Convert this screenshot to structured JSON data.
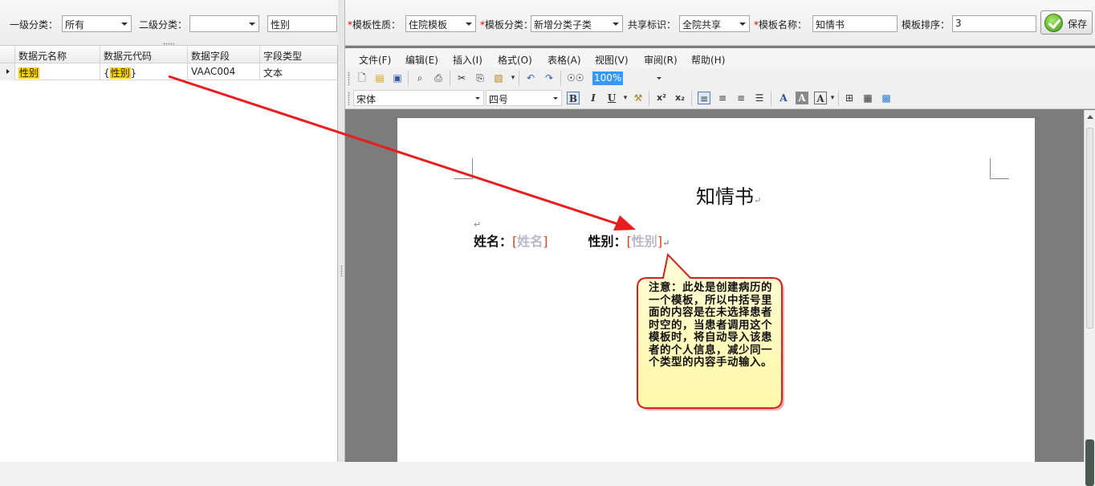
{
  "left": {
    "filter": {
      "level1_label": "一级分类：",
      "level1_value": "所有",
      "level2_label": "二级分类：",
      "level2_value": "",
      "search_value": "性别"
    },
    "grid": {
      "columns": [
        "数据元名称",
        "数据元代码",
        "数据字段",
        "字段类型"
      ],
      "rows": [
        {
          "name": "性别",
          "code_open": "{",
          "code": "性别",
          "code_close": "}",
          "field": "VAAC004",
          "type": "文本"
        }
      ]
    }
  },
  "template": {
    "nature_label": "模板性质：",
    "nature_value": "住院模板",
    "category_label": "模板分类：",
    "category_value": "新增分类子类",
    "share_label": "共享标识：",
    "share_value": "全院共享",
    "name_label": "模板名称：",
    "name_value": "知情书",
    "order_label": "模板排序：",
    "order_value": "3",
    "required_mark": "*",
    "save_label": "保存"
  },
  "menu": [
    "文件(F)",
    "编辑(E)",
    "插入(I)",
    "格式(O)",
    "表格(A)",
    "视图(V)",
    "审阅(R)",
    "帮助(H)"
  ],
  "toolbar": {
    "zoom": "100%",
    "font_name": "宋体",
    "font_size": "四号",
    "bold": "B",
    "italic": "I",
    "underline": "U"
  },
  "document": {
    "title": "知情书",
    "para_mark": "↵",
    "name_label": "姓名：",
    "name_field": "姓名",
    "gender_label": "性别：",
    "gender_field": "性别",
    "bracket_open": "[",
    "bracket_close": "]"
  },
  "callout": {
    "text": "注意：此处是创建病历的一个模板，所以中括号里面的内容是在未选择患者时空的，当患者调用这个模板时，将自动导入该患者的个人信息，减少同一个类型的内容手动输入。"
  },
  "colors": {
    "highlight": "#ffd000",
    "arrow": "#e81e1e",
    "callout_fill": "#fffcc4",
    "callout_border": "#d42020",
    "zoom_select": "#3399ff"
  }
}
